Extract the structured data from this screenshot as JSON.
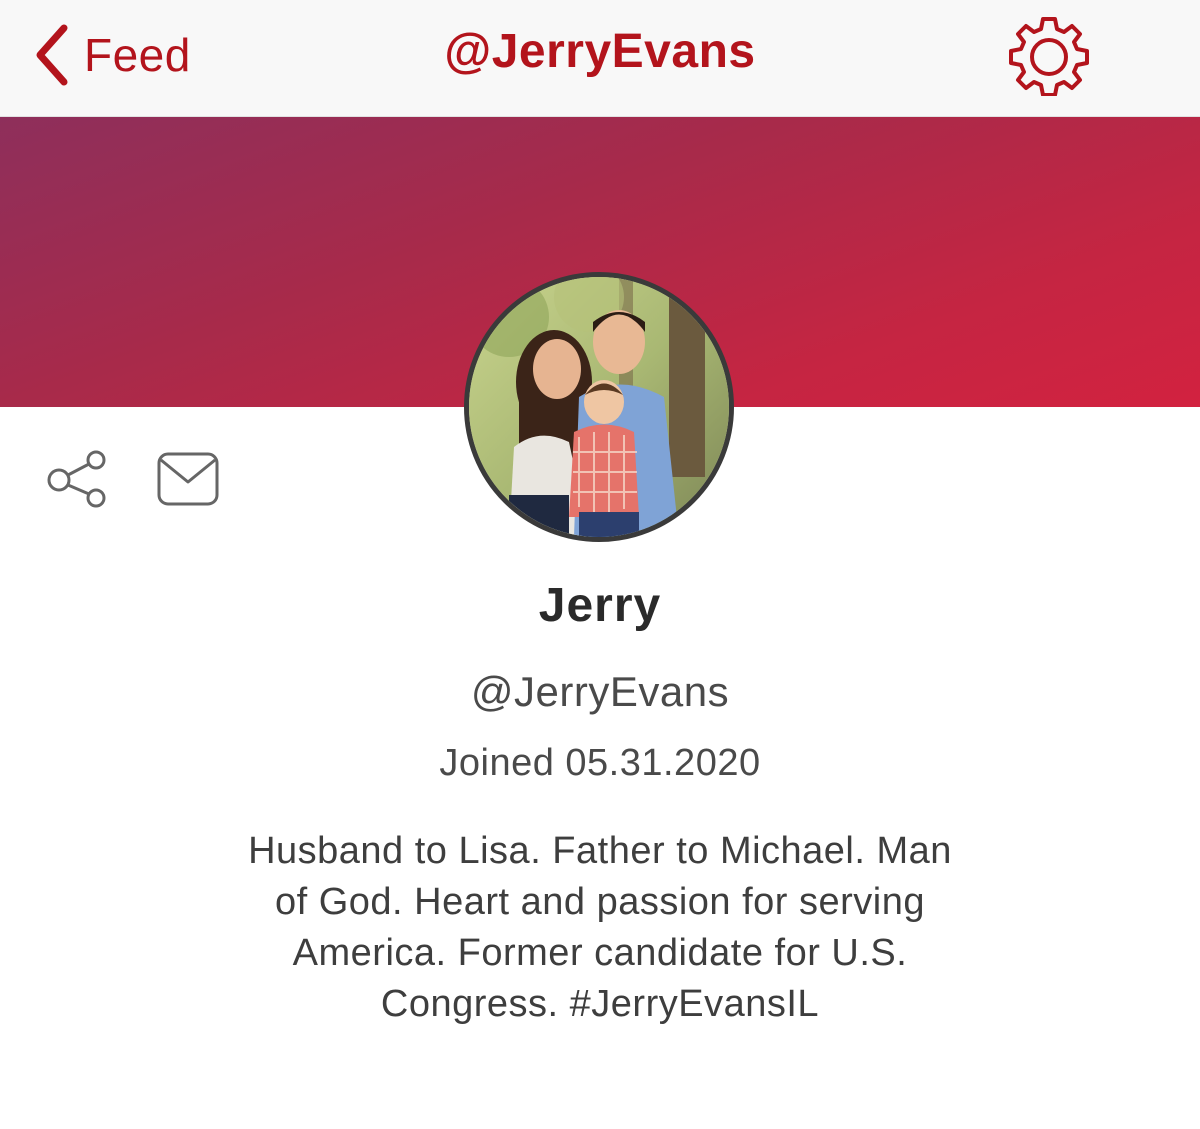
{
  "nav": {
    "back_label": "Feed",
    "title": "@JerryEvans",
    "back_icon": "chevron-left-icon",
    "settings_icon": "gear-icon"
  },
  "profile": {
    "display_name": "Jerry",
    "handle": "@JerryEvans",
    "joined": "Joined 05.31.2020",
    "bio": "Husband to Lisa. Father to Michael. Man of God. Heart and passion for serving America. Former candidate for U.S. Congress. #JerryEvansIL",
    "avatar_alt": "family photo"
  },
  "actions": {
    "share_icon": "share-icon",
    "message_icon": "mail-icon"
  },
  "colors": {
    "accent": "#b3141c",
    "cover_start": "#8e2f5b",
    "cover_end": "#d22240"
  }
}
